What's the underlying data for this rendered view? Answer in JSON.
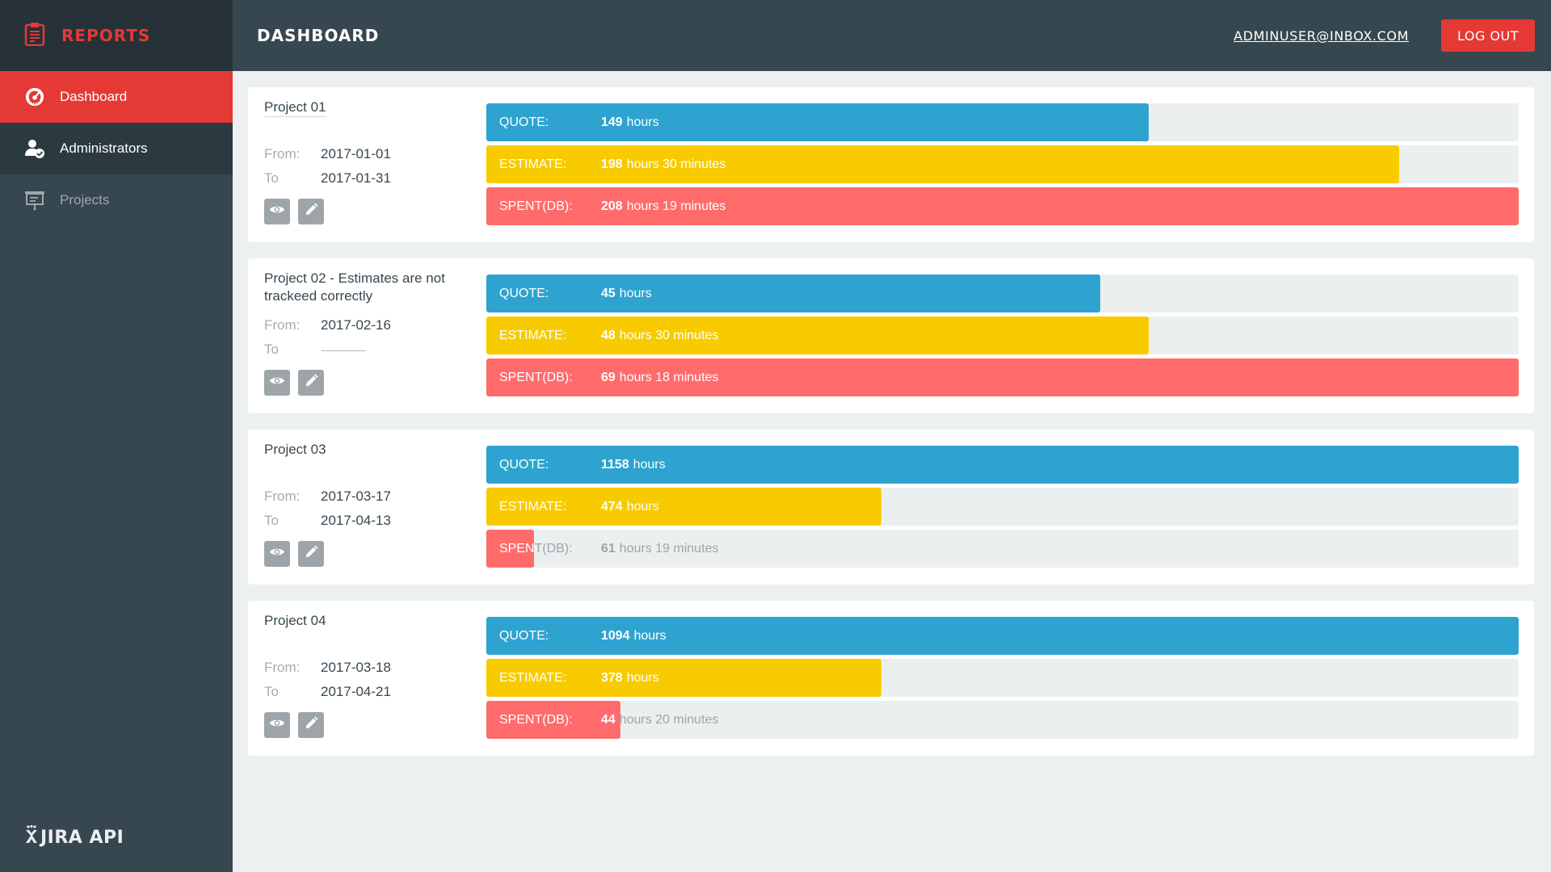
{
  "sidebar": {
    "brand": {
      "label": "REPORTS",
      "icon": "clipboard-icon"
    },
    "items": [
      {
        "label": "Dashboard",
        "icon": "dashboard-gauge-icon",
        "state": "active"
      },
      {
        "label": "Administrators",
        "icon": "user-check-icon",
        "state": "dark"
      },
      {
        "label": "Projects",
        "icon": "presentation-board-icon",
        "state": "muted"
      }
    ],
    "footer_logo": "JIRA API"
  },
  "header": {
    "title": "DASHBOARD",
    "user_email": "ADMINUSER@INBOX.COM",
    "logout_label": "LOG OUT"
  },
  "labels": {
    "from": "From:",
    "to": "To",
    "quote": "QUOTE:",
    "estimate": "ESTIMATE:",
    "spent": "SPENT(DB):"
  },
  "colors": {
    "accent_red": "#e53935",
    "quote": "#2ea3d0",
    "estimate": "#f8cb00",
    "spent": "#ff6b6b",
    "sidebar": "#37474f",
    "header": "#37474f",
    "background": "#ecf0f0"
  },
  "projects": [
    {
      "title": "Project 01",
      "underlined": true,
      "from": "2017-01-01",
      "to": "2017-01-31",
      "quote": {
        "num": "149",
        "rest": "hours",
        "fill": 0.642
      },
      "estimate": {
        "num": "198",
        "rest": "hours 30 minutes",
        "fill": 0.884
      },
      "spent": {
        "num": "208",
        "rest": "hours 19 minutes",
        "fill": 1.0
      }
    },
    {
      "title": "Project 02 - Estimates are not trackeed correctly",
      "underlined": false,
      "from": "2017-02-16",
      "to": "---------------",
      "to_empty": true,
      "quote": {
        "num": "45",
        "rest": "hours",
        "fill": 0.595
      },
      "estimate": {
        "num": "48",
        "rest": "hours 30 minutes",
        "fill": 0.642
      },
      "spent": {
        "num": "69",
        "rest": "hours 18 minutes",
        "fill": 1.0
      }
    },
    {
      "title": "Project 03",
      "underlined": false,
      "from": "2017-03-17",
      "to": "2017-04-13",
      "quote": {
        "num": "1158",
        "rest": "hours",
        "fill": 1.0
      },
      "estimate": {
        "num": "474",
        "rest": "hours",
        "fill": 0.383
      },
      "spent": {
        "num": "61",
        "rest": "hours 19 minutes",
        "fill": 0.046
      }
    },
    {
      "title": "Project 04",
      "underlined": false,
      "from": "2017-03-18",
      "to": "2017-04-21",
      "quote": {
        "num": "1094",
        "rest": "hours",
        "fill": 1.0
      },
      "estimate": {
        "num": "378",
        "rest": "hours",
        "fill": 0.383
      },
      "spent": {
        "num": "44",
        "rest": "hours 20 minutes",
        "fill": 0.13
      }
    }
  ],
  "action_icons": [
    "eye-icon",
    "pencil-icon"
  ]
}
